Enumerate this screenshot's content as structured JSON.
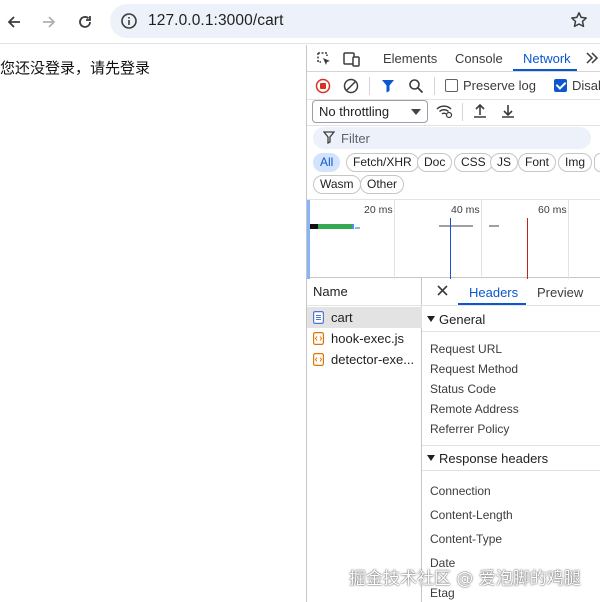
{
  "browser": {
    "url": "127.0.0.1:3000/cart"
  },
  "page": {
    "message": "您还没登录，请先登录"
  },
  "devtools": {
    "tabs": [
      "Elements",
      "Console",
      "Network"
    ],
    "active_tab": "Network",
    "preserve_log_label": "Preserve log",
    "disable_cache_label": "Disab",
    "throttling": "No throttling",
    "filter_placeholder": "Filter",
    "type_filters": [
      "All",
      "Fetch/XHR",
      "Doc",
      "CSS",
      "JS",
      "Font",
      "Img",
      "Wasm",
      "Other"
    ],
    "active_type_filter": "All",
    "timeline_ticks": [
      "20 ms",
      "40 ms",
      "60 ms"
    ],
    "name_column_header": "Name",
    "requests": [
      {
        "name": "cart",
        "type": "document"
      },
      {
        "name": "hook-exec.js",
        "type": "script"
      },
      {
        "name": "detector-exe...",
        "type": "script"
      }
    ],
    "detail_tabs": [
      "Headers",
      "Preview"
    ],
    "active_detail_tab": "Headers",
    "general_section": {
      "title": "General",
      "keys": [
        "Request URL",
        "Request Method",
        "Status Code",
        "Remote Address",
        "Referrer Policy"
      ]
    },
    "response_section": {
      "title": "Response headers",
      "keys": [
        "Connection",
        "Content-Length",
        "Content-Type",
        "Date",
        "Etag"
      ]
    }
  },
  "watermark": "掘金技术社区 @ 爱泡脚的鸡腿",
  "colors": {
    "accent": "#0b57d0",
    "record_red": "#d93025",
    "omnibox_bg": "#edf2fa",
    "chip_active_bg": "#d3e3fd"
  }
}
